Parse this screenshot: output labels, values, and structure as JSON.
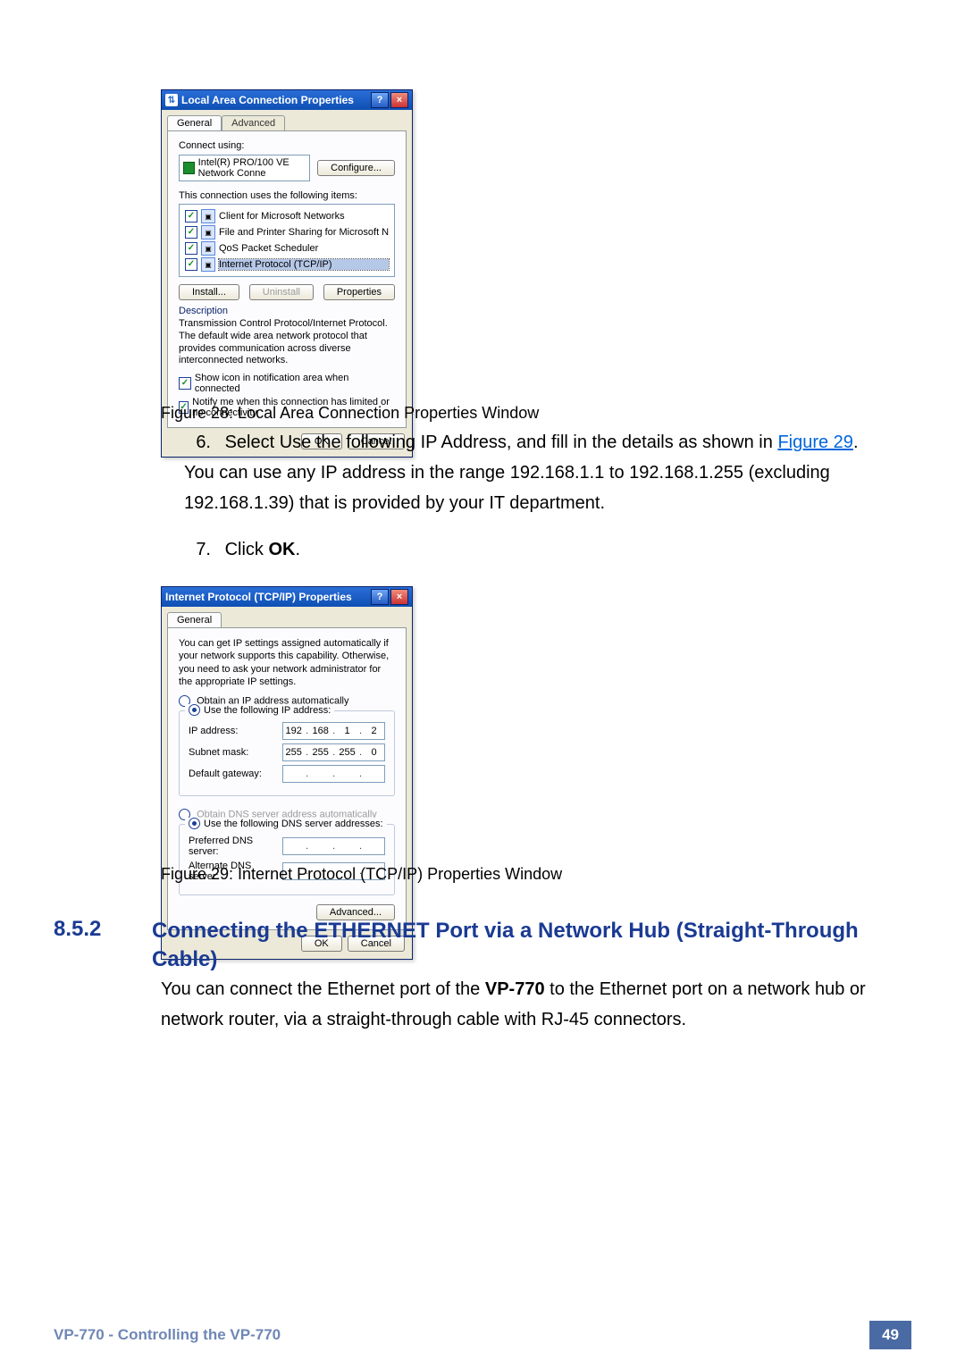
{
  "dialog1": {
    "title": "Local Area Connection Properties",
    "tabs": {
      "general": "General",
      "advanced": "Advanced"
    },
    "connect_using_label": "Connect using:",
    "nic_name": "Intel(R) PRO/100 VE Network Conne",
    "configure_btn": "Configure...",
    "items_label": "This connection uses the following items:",
    "items": [
      {
        "label": "Client for Microsoft Networks"
      },
      {
        "label": "File and Printer Sharing for Microsoft Networks"
      },
      {
        "label": "QoS Packet Scheduler"
      },
      {
        "label": "Internet Protocol (TCP/IP)"
      }
    ],
    "install_btn": "Install...",
    "uninstall_btn": "Uninstall",
    "properties_btn": "Properties",
    "desc_title": "Description",
    "desc_text": "Transmission Control Protocol/Internet Protocol. The default wide area network protocol that provides communication across diverse interconnected networks.",
    "show_icon": "Show icon in notification area when connected",
    "notify": "Notify me when this connection has limited or no connectivity",
    "ok": "OK",
    "cancel": "Cancel"
  },
  "caption1": "Figure 28: Local Area Connection Properties Window",
  "steps": {
    "s6a": "Select Use the following IP Address, and fill in the details as shown in ",
    "s6link": "Figure 29",
    "s6b": ". You can use any IP address in the range 192.168.1.1 to 192.168.1.255 (excluding 192.168.1.39) that is provided by your IT department.",
    "s7a": "Click ",
    "s7b": "OK",
    "s7c": "."
  },
  "dialog2": {
    "title": "Internet Protocol (TCP/IP) Properties",
    "tab": "General",
    "info": "You can get IP settings assigned automatically if your network supports this capability. Otherwise, you need to ask your network administrator for the appropriate IP settings.",
    "r_auto": "Obtain an IP address automatically",
    "r_use": "Use the following IP address:",
    "ip_label": "IP address:",
    "ip": [
      "192",
      "168",
      "1",
      "2"
    ],
    "mask_label": "Subnet mask:",
    "mask": [
      "255",
      "255",
      "255",
      "0"
    ],
    "gw_label": "Default gateway:",
    "dns_auto": "Obtain DNS server address automatically",
    "dns_use": "Use the following DNS server addresses:",
    "pref_dns": "Preferred DNS server:",
    "alt_dns": "Alternate DNS server:",
    "advanced": "Advanced...",
    "ok": "OK",
    "cancel": "Cancel"
  },
  "caption2": "Figure 29: Internet Protocol (TCP/IP) Properties Window",
  "section": {
    "num": "8.5.2",
    "title": "Connecting the ETHERNET Port via a Network Hub (Straight-Through Cable)"
  },
  "body": {
    "p1a": "You can connect the Ethernet port of the ",
    "p1b": "VP-770",
    "p1c": " to the Ethernet port on a network hub or network router, via a straight-through cable with RJ-45 connectors."
  },
  "footer": {
    "label": "VP-770 - Controlling the VP-770",
    "page": "49"
  }
}
